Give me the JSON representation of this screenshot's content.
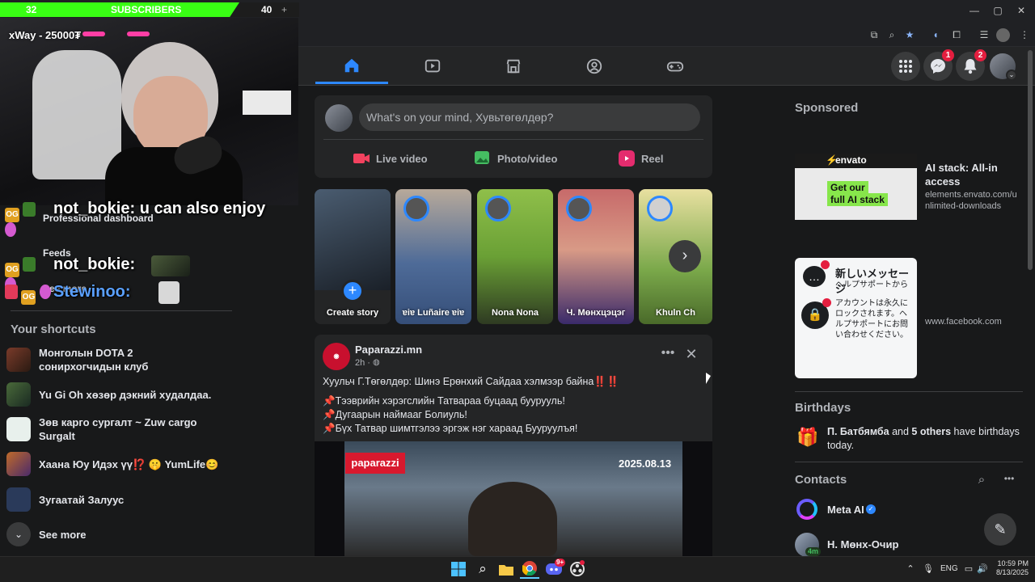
{
  "overlay": {
    "sub_current": "32",
    "sub_label": "SUBSCRIBERS",
    "sub_goal": "40",
    "sub_plus": "+",
    "donation": "xWay - 25000₮",
    "chat": [
      {
        "user": "not_bokie:",
        "message": "u can also enjoy"
      },
      {
        "user": "not_bokie:",
        "message": ""
      },
      {
        "user": "Stewinoo:",
        "message": ""
      }
    ]
  },
  "browser": {
    "window_controls": [
      "—",
      "▢",
      "✕"
    ]
  },
  "header": {
    "messenger_badge": "1",
    "notifications_badge": "2"
  },
  "left": {
    "items_partial": [
      {
        "label": "Professional dashboard"
      },
      {
        "label": "Feeds"
      },
      {
        "label": "See more"
      }
    ],
    "shortcuts_title": "Your shortcuts",
    "shortcuts": [
      {
        "label": "Монголын DOTA 2 сонирхогчидын клуб"
      },
      {
        "label": "Yu Gi Oh хөзөр дэкний худалдаа."
      },
      {
        "label": "Зөв карго сургалт ~ Zuw cargo Surgalt"
      },
      {
        "label": "Хаана Юу Идэх үү⁉️ 🤫 YumLife😊"
      },
      {
        "label": "Зугаатай Залуус"
      }
    ],
    "see_more": "See more"
  },
  "composer": {
    "placeholder": "What's on your mind, Хувьтөгөлдөр?",
    "live": "Live video",
    "photo": "Photo/video",
    "reel": "Reel"
  },
  "stories": {
    "create": "Create story",
    "items": [
      "ɐiɐ Luñaire ɐiɐ",
      "Nona Nona",
      "Ч. Мөнхцэцэг",
      "Khuln Ch"
    ]
  },
  "post": {
    "author": "Paparazzi.mn",
    "time": "2h ·",
    "lines": [
      "Хуульч Г.Төгөлдөр: Шинэ Ерөнхий Сайдаа хэлмээр байна‼️‼️",
      "📌Тээврийн хэрэгслийн Татвараа буцаад буурууль!",
      "📌Дугаарын наймааг Болиуль!",
      "📌Бүх Татвар шимтгэлээ эргэж нэг хараад Бууруулъя!"
    ],
    "image_brand": "paparazzi",
    "image_date": "2025.08.13"
  },
  "right": {
    "sponsored": "Sponsored",
    "ads": [
      {
        "brand": "envato",
        "ad_text_1": "Get our",
        "ad_text_2": "full AI stack",
        "title": "AI stack: All-in access",
        "url": "elements.envato.com/unlimited-downloads"
      },
      {
        "popup_title": "新しいメッセージ",
        "popup_sub": "ヘルプサポートから",
        "popup_body": "アカウントは永久にロックされます。ヘルプサポートにお問い合わせください。",
        "url": "www.facebook.com"
      }
    ],
    "birthdays_title": "Birthdays",
    "birthday_name": "П. Батбямба",
    "birthday_and": "and",
    "birthday_others": "5 others",
    "birthday_text": "have birthdays today.",
    "contacts_title": "Contacts",
    "contacts": [
      {
        "name": "Meta AI"
      },
      {
        "name": "Н. Мөнх-Очир",
        "status": "4m"
      }
    ]
  },
  "taskbar": {
    "lang": "ENG",
    "time": "10:59 PM",
    "date": "8/13/2025",
    "discord_badge": "9+"
  },
  "colors": {
    "accent": "#2d88ff",
    "badge": "#e41e3f",
    "sub_green": "#39ff14"
  }
}
